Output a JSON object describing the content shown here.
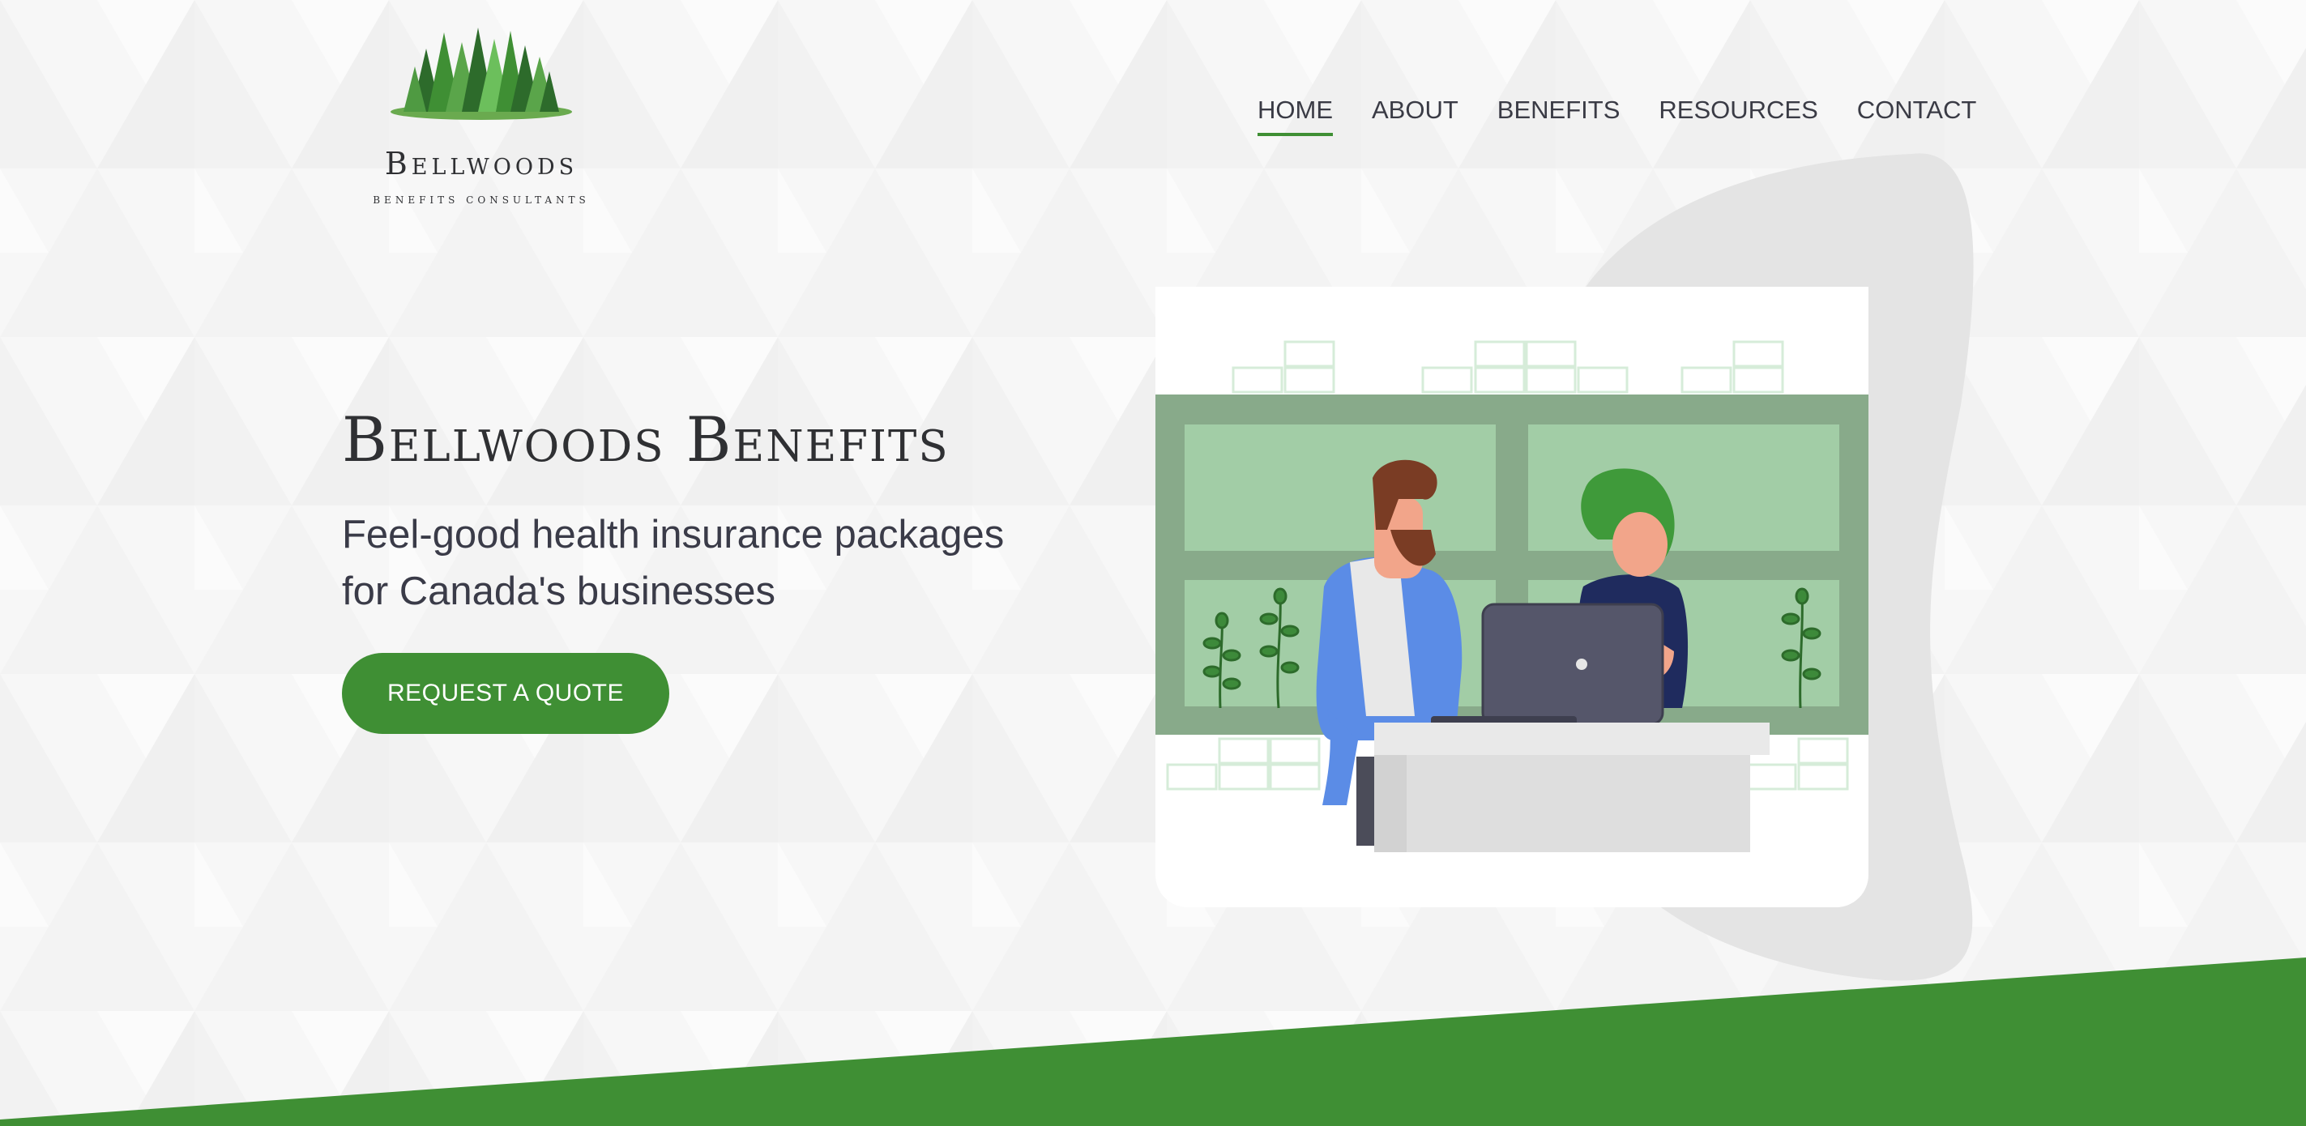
{
  "brand": {
    "name": "Bellwoods",
    "tagline": "BENEFITS CONSULTANTS"
  },
  "nav": {
    "items": [
      {
        "label": "HOME",
        "active": true
      },
      {
        "label": "ABOUT",
        "active": false
      },
      {
        "label": "BENEFITS",
        "active": false
      },
      {
        "label": "RESOURCES",
        "active": false
      },
      {
        "label": "CONTACT",
        "active": false
      }
    ]
  },
  "hero": {
    "title": "Bellwoods Benefits",
    "subtitle_line1": "Feel-good health insurance packages",
    "subtitle_line2": "for Canada's businesses",
    "cta_label": "REQUEST A QUOTE"
  },
  "colors": {
    "accent": "#3f8f34",
    "background": "#f7f7f7",
    "text": "#2f3033"
  },
  "icons": {
    "logo": "pine-trees-logo",
    "illustration": "two-people-at-laptop-illustration"
  }
}
